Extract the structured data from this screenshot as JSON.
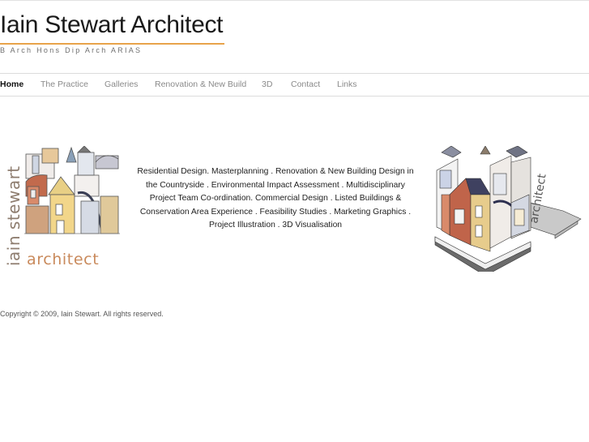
{
  "header": {
    "title": "Iain Stewart Architect",
    "tagline": "B Arch Hons Dip Arch ARIAS"
  },
  "nav": {
    "items": [
      "Home",
      "The Practice",
      "Galleries",
      "Renovation & New Build",
      "3D",
      "Contact",
      "Links"
    ],
    "active": "Home"
  },
  "logo": {
    "word_top": "iain stewart",
    "word_bottom": "architect"
  },
  "main": {
    "description": "Residential Design. Masterplanning . Renovation & New Building Design in the Countryside . Environmental Impact Assessment . Multidisciplinary Project Team Co-ordination. Commercial Design . Listed Buildings & Conservation Area Experience .  Feasibility Studies . Marketing Graphics . Project Illustration . 3D Visualisation"
  },
  "footer": {
    "copyright": "Copyright © 2009, Iain Stewart. All rights reserved."
  },
  "colors": {
    "accent": "#e8a34a",
    "logo_text": "#8e7d6f",
    "logo_architect": "#c98a5c",
    "nav_text": "#8a8a8a"
  }
}
